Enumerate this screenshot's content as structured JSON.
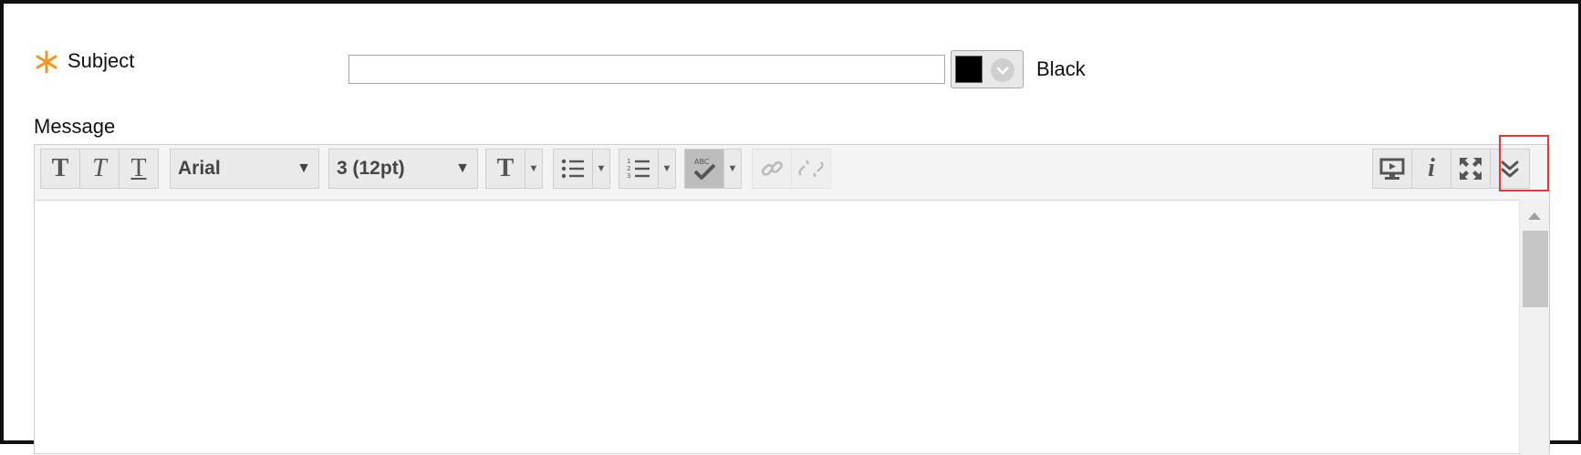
{
  "form": {
    "subject_label": "Subject",
    "subject_value": "",
    "message_label": "Message",
    "text_color": {
      "swatch": "#000000",
      "name": "Black"
    }
  },
  "toolbar": {
    "format_buttons": [
      {
        "label": "T",
        "name": "bold"
      },
      {
        "label": "T",
        "name": "italic"
      },
      {
        "label": "T",
        "name": "underline"
      }
    ],
    "font_family": {
      "value": "Arial"
    },
    "font_size": {
      "value": "3 (12pt)"
    },
    "right_buttons": [
      "preview-icon",
      "info-icon",
      "fullscreen-icon",
      "expand-toolbar-icon"
    ]
  },
  "colors": {
    "required": "#f7941d",
    "highlight": "#e53935",
    "toolbar_bg": "#f4f4f4"
  }
}
